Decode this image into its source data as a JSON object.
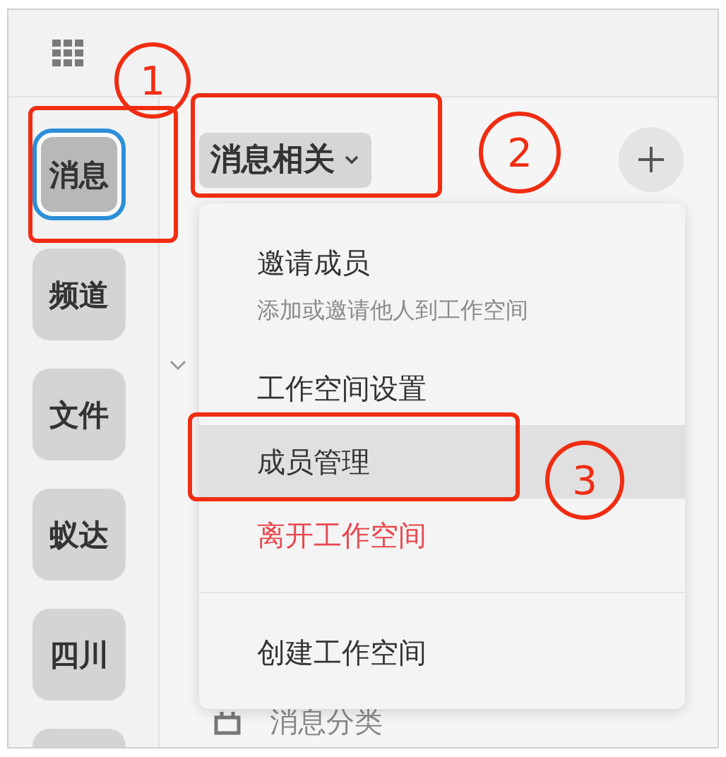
{
  "sidebar": {
    "items": [
      {
        "label": "消息",
        "selected": true
      },
      {
        "label": "频道",
        "selected": false
      },
      {
        "label": "文件",
        "selected": false
      },
      {
        "label": "蚁达",
        "selected": false
      },
      {
        "label": "四川",
        "selected": false
      },
      {
        "selected": false
      }
    ]
  },
  "header": {
    "workspace": "消息相关"
  },
  "background_list": {
    "category": "消息分类"
  },
  "menu": {
    "items": [
      {
        "kind": "normal",
        "label": "邀请成员",
        "subtitle": "添加或邀请他人到工作空间",
        "selected": false
      },
      {
        "kind": "normal",
        "label": "工作空间设置",
        "selected": false
      },
      {
        "kind": "normal",
        "label": "成员管理",
        "selected": true
      },
      {
        "kind": "danger",
        "label": "离开工作空间",
        "selected": false
      },
      {
        "kind": "divider"
      },
      {
        "kind": "normal",
        "label": "创建工作空间",
        "selected": false
      }
    ]
  },
  "annotations": [
    {
      "label": "1"
    },
    {
      "label": "2"
    },
    {
      "label": "3"
    }
  ]
}
